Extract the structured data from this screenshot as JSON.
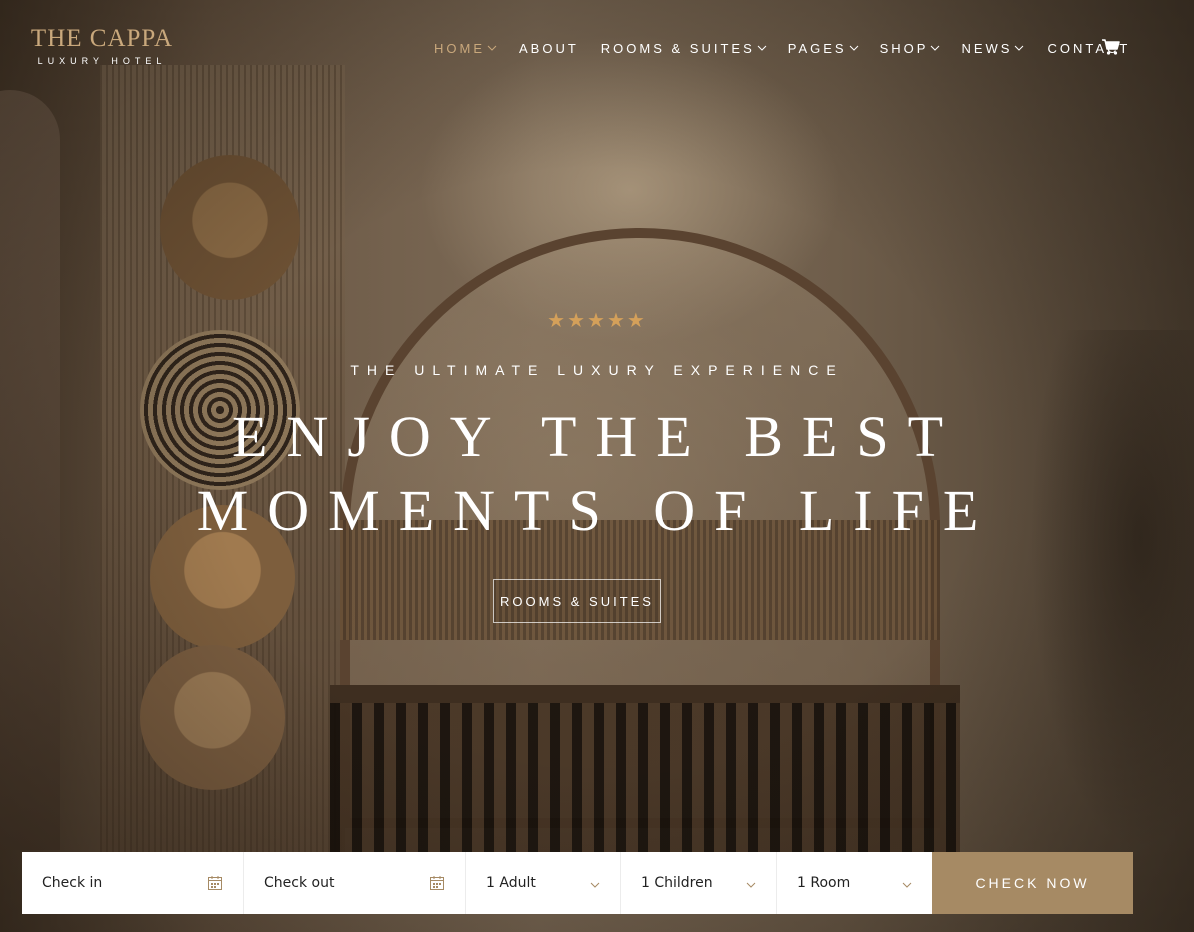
{
  "brand": {
    "name": "THE CAPPA",
    "subtitle": "LUXURY HOTEL"
  },
  "nav": {
    "items": [
      {
        "label": "HOME",
        "dropdown": true,
        "active": true
      },
      {
        "label": "ABOUT",
        "dropdown": false
      },
      {
        "label": "ROOMS & SUITES",
        "dropdown": true
      },
      {
        "label": "PAGES",
        "dropdown": true
      },
      {
        "label": "SHOP",
        "dropdown": true
      },
      {
        "label": "NEWS",
        "dropdown": true
      },
      {
        "label": "CONTACT",
        "dropdown": false
      }
    ],
    "cart_icon": "cart-icon"
  },
  "hero": {
    "stars": "★★★★★",
    "rating": 5,
    "tagline": "THE ULTIMATE LUXURY EXPERIENCE",
    "headline_line1": "ENJOY THE BEST",
    "headline_line2": "MOMENTS OF LIFE",
    "button_label": "ROOMS & SUITES"
  },
  "booking": {
    "check_in": "Check in",
    "check_out": "Check out",
    "adults": "1 Adult",
    "children": "1 Children",
    "rooms": "1 Room",
    "submit_label": "CHECK NOW"
  },
  "colors": {
    "accent": "#c9a87c",
    "button": "#a68a64",
    "stars": "#d4a05a",
    "text_light": "#ffffff"
  }
}
